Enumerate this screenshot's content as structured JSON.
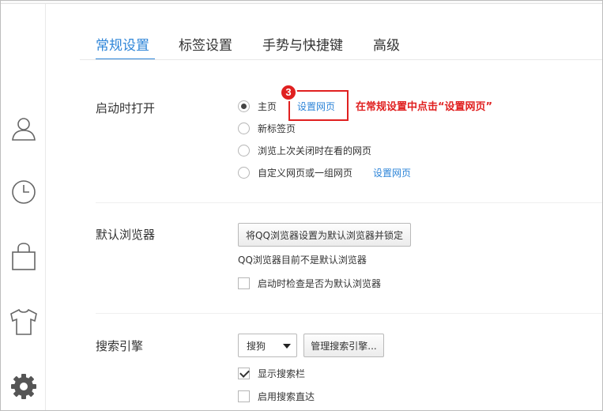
{
  "tabs": [
    {
      "label": "常规设置",
      "active": true
    },
    {
      "label": "标签设置",
      "active": false
    },
    {
      "label": "手势与快捷键",
      "active": false
    },
    {
      "label": "高级",
      "active": false
    }
  ],
  "sidebar": {
    "icons": [
      "user-icon",
      "history-clock-icon",
      "shopping-bag-icon",
      "tshirt-skin-icon",
      "gear-icon"
    ]
  },
  "startup": {
    "title": "启动时打开",
    "options": [
      {
        "label": "主页",
        "checked": true
      },
      {
        "label": "新标签页",
        "checked": false
      },
      {
        "label": "浏览上次关闭时在看的网页",
        "checked": false
      },
      {
        "label": "自定义网页或一组网页",
        "checked": false
      }
    ],
    "homepage_link": "设置网页",
    "custom_link": "设置网页"
  },
  "annotation": {
    "step": "3",
    "text": "在常规设置中点击“设置网页”",
    "color": "#e02020"
  },
  "default_browser": {
    "title": "默认浏览器",
    "set_button": "将QQ浏览器设置为默认浏览器并锁定",
    "status": "QQ浏览器目前不是默认浏览器",
    "check_on_start": {
      "label": "启动时检查是否为默认浏览器",
      "checked": false
    }
  },
  "search_engine": {
    "title": "搜索引擎",
    "selected": "搜狗",
    "manage_button": "管理搜索引擎...",
    "show_search_bar": {
      "label": "显示搜索栏",
      "checked": true
    },
    "direct_search": {
      "label": "启用搜索直达",
      "checked": false
    }
  },
  "colors": {
    "accent": "#2e85d8",
    "annotation_red": "#e02020"
  }
}
